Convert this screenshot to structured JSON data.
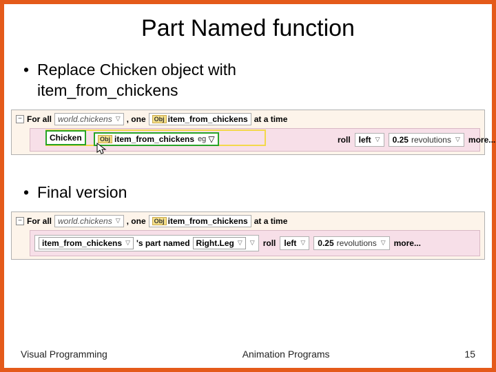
{
  "title": "Part Named function",
  "bullet1a": "Replace Chicken object with",
  "bullet1b": "item_from_chickens",
  "bullet2": "Final version",
  "code": {
    "forall": "For all",
    "worldchickens": "world.chickens",
    "comma_one": ", one",
    "item_from_chickens": "item_from_chickens",
    "at_a_time": "at a time",
    "chicken": "Chicken",
    "drag_eg": "eg",
    "roll": "roll",
    "left": "left",
    "rev_num": "0.25",
    "revolutions": " revolutions",
    "more": "more...",
    "obj": "Obj",
    "parts_named": "'s part named",
    "rightleg": "Right.Leg"
  },
  "footer": {
    "left": "Visual Programming",
    "center": "Animation Programs",
    "right": "15"
  }
}
